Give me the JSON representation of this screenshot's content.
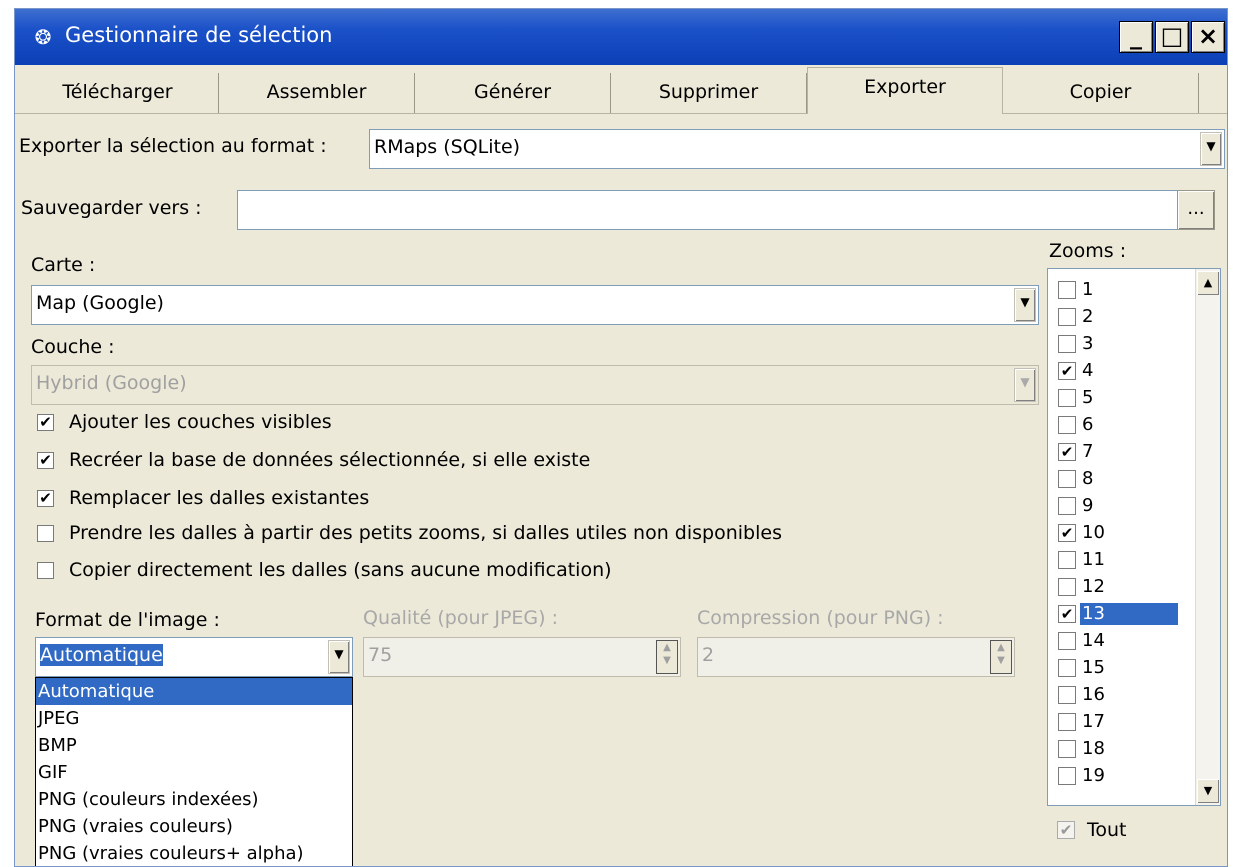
{
  "window": {
    "title": "Gestionnaire de sélection",
    "minimize": "_",
    "maximize": "□",
    "close": "×"
  },
  "tabs": [
    {
      "label": "Télécharger"
    },
    {
      "label": "Assembler"
    },
    {
      "label": "Générer"
    },
    {
      "label": "Supprimer"
    },
    {
      "label": "Exporter",
      "active": true
    },
    {
      "label": "Copier"
    }
  ],
  "export": {
    "format_label": "Exporter la sélection au format :",
    "format_value": "RMaps (SQLite)"
  },
  "save": {
    "label": "Sauvegarder vers :",
    "value": "",
    "browse": "..."
  },
  "map": {
    "label": "Carte :",
    "value": "Map (Google)"
  },
  "layer": {
    "label": "Couche :",
    "value": "Hybrid (Google)"
  },
  "options": [
    {
      "label": "Ajouter les couches visibles",
      "checked": true
    },
    {
      "label": "Recréer la base de données sélectionnée, si elle existe",
      "checked": true
    },
    {
      "label": "Remplacer les dalles existantes",
      "checked": true
    },
    {
      "label": "Prendre les dalles à partir des petits zooms, si dalles utiles non disponibles",
      "checked": false
    },
    {
      "label": "Copier directement les dalles (sans aucune modification)",
      "checked": false
    }
  ],
  "image_format": {
    "label": "Format de l'image :",
    "value": "Automatique",
    "options": [
      "Automatique",
      "JPEG",
      "BMP",
      "GIF",
      "PNG (couleurs indexées)",
      "PNG (vraies couleurs)",
      "PNG (vraies couleurs+ alpha)"
    ],
    "selected_index": 0
  },
  "quality": {
    "label": "Qualité (pour JPEG) :",
    "value": "75"
  },
  "compression": {
    "label": "Compression (pour PNG) :",
    "value": "2"
  },
  "zooms": {
    "label": "Zooms :",
    "items": [
      {
        "label": "1",
        "checked": false
      },
      {
        "label": "2",
        "checked": false
      },
      {
        "label": "3",
        "checked": false
      },
      {
        "label": "4",
        "checked": true
      },
      {
        "label": "5",
        "checked": false
      },
      {
        "label": "6",
        "checked": false
      },
      {
        "label": "7",
        "checked": true
      },
      {
        "label": "8",
        "checked": false
      },
      {
        "label": "9",
        "checked": false
      },
      {
        "label": "10",
        "checked": true
      },
      {
        "label": "11",
        "checked": false
      },
      {
        "label": "12",
        "checked": false
      },
      {
        "label": "13",
        "checked": true,
        "highlighted": true
      },
      {
        "label": "14",
        "checked": false
      },
      {
        "label": "15",
        "checked": false
      },
      {
        "label": "16",
        "checked": false
      },
      {
        "label": "17",
        "checked": false
      },
      {
        "label": "18",
        "checked": false
      },
      {
        "label": "19",
        "checked": false
      }
    ],
    "all_label": "Tout",
    "all_checked": true
  },
  "colors": {
    "titlebar": "#0a3fb6",
    "selection": "#316ac5",
    "face": "#ece9d8"
  }
}
